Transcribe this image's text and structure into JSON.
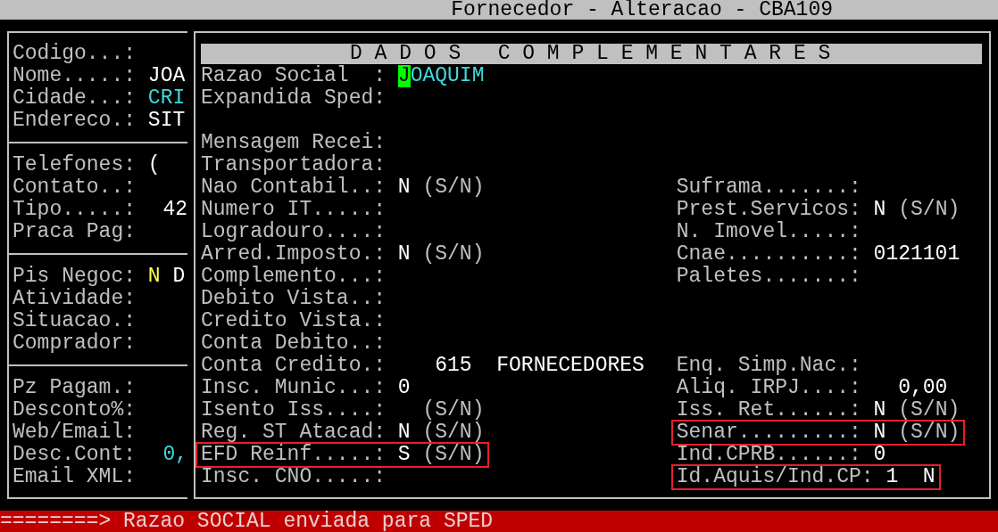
{
  "window": {
    "title": "Fornecedor - Alteracao - CBA109"
  },
  "summary_panel": {
    "sections": [
      {
        "rows": [
          {
            "label": "Codigo...:"
          },
          {
            "label": "Nome.....:",
            "values": [
              {
                "text": "JOA",
                "color": "#ffffff",
                "kind": "text"
              }
            ]
          },
          {
            "label": "Cidade...:",
            "values": [
              {
                "text": "CRI",
                "color": "#40d8d8",
                "kind": "text"
              }
            ]
          },
          {
            "label": "Endereco.:",
            "values": [
              {
                "text": "SIT",
                "color": "#ffffff",
                "kind": "text"
              }
            ]
          }
        ]
      },
      {
        "rows": [
          {
            "label": "Telefones:",
            "values": [
              {
                "text": "(",
                "color": "#ffffff",
                "kind": "text"
              }
            ]
          },
          {
            "label": "Contato..:"
          },
          {
            "label": "Tipo.....:",
            "values": [
              {
                "text": "42",
                "color": "#ffffff",
                "kind": "number"
              }
            ]
          },
          {
            "label": "Praca Pag:"
          }
        ]
      },
      {
        "rows": [
          {
            "label": "Pis Negoc:",
            "values": [
              {
                "text": "N",
                "color": "#ffff55",
                "kind": "text"
              },
              {
                "text": "D",
                "color": "#ffffff",
                "kind": "text"
              }
            ]
          },
          {
            "label": "Atividade:"
          },
          {
            "label": "Situacao.:"
          },
          {
            "label": "Comprador:"
          }
        ]
      },
      {
        "rows": [
          {
            "label": "Pz Pagam.:"
          },
          {
            "label": "Desconto%:"
          },
          {
            "label": "Web/Email:"
          },
          {
            "label": "Desc.Cont:",
            "values": [
              {
                "text": "0,",
                "color": "#40d8d8",
                "kind": "number"
              }
            ]
          },
          {
            "label": "Email XML:"
          }
        ]
      }
    ]
  },
  "details_panel": {
    "heading": "D A D O S   C O M P L E M E N T A R E S",
    "rows": [
      {
        "kind": "fields",
        "left": {
          "label": "Razao Social  :",
          "value": {
            "text": "JOAQUIM",
            "color": "#40d8d8",
            "kind": "text",
            "cursor": true
          },
          "highlighted": false
        }
      },
      {
        "kind": "fields",
        "left": {
          "label": "Expandida Sped:",
          "highlighted": false
        }
      },
      {
        "kind": "blank"
      },
      {
        "kind": "fields",
        "left": {
          "label": "Mensagem Recei:",
          "highlighted": false
        }
      },
      {
        "kind": "fields",
        "left": {
          "label": "Transportadora:",
          "highlighted": false
        }
      },
      {
        "kind": "fields",
        "left": {
          "label": "Nao Contabil..:",
          "value": {
            "text": "N",
            "color": "#ffffff",
            "kind": "text"
          },
          "hint": "(S/N)",
          "highlighted": false
        },
        "right": {
          "label": "Suframa.......:",
          "highlighted": false
        }
      },
      {
        "kind": "fields",
        "left": {
          "label": "Numero IT.....:",
          "highlighted": false
        },
        "right": {
          "label": "Prest.Servicos:",
          "value": {
            "text": "N",
            "color": "#ffffff",
            "kind": "text"
          },
          "hint": "(S/N)",
          "highlighted": false
        }
      },
      {
        "kind": "fields",
        "left": {
          "label": "Logradouro....:",
          "highlighted": false
        },
        "right": {
          "label": "N. Imovel.....:",
          "highlighted": false
        }
      },
      {
        "kind": "fields",
        "left": {
          "label": "Arred.Imposto.:",
          "value": {
            "text": "N",
            "color": "#ffffff",
            "kind": "text"
          },
          "hint": "(S/N)",
          "highlighted": false
        },
        "right": {
          "label": "Cnae..........:",
          "value": {
            "text": "0121101",
            "color": "#ffffff",
            "kind": "text"
          },
          "highlighted": false
        }
      },
      {
        "kind": "fields",
        "left": {
          "label": "Complemento...:",
          "highlighted": false
        },
        "right": {
          "label": "Paletes.......:",
          "highlighted": false
        }
      },
      {
        "kind": "fields",
        "left": {
          "label": "Debito Vista..:",
          "highlighted": false
        }
      },
      {
        "kind": "fields",
        "left": {
          "label": "Credito Vista.:",
          "highlighted": false
        }
      },
      {
        "kind": "fields",
        "left": {
          "label": "Conta Debito..:",
          "highlighted": false
        }
      },
      {
        "kind": "fields",
        "left": {
          "label": "Conta Credito.:",
          "value": {
            "text": "615",
            "color": "#ffffff",
            "kind": "number"
          },
          "note": "FORNECEDORES",
          "highlighted": false
        },
        "right": {
          "label": "Enq. Simp.Nac.:",
          "highlighted": false
        }
      },
      {
        "kind": "fields",
        "left": {
          "label": "Insc. Munic...:",
          "value": {
            "text": "0",
            "color": "#ffffff",
            "kind": "text"
          },
          "highlighted": false
        },
        "right": {
          "label": "Aliq. IRPJ....:",
          "value": {
            "text": "0,00",
            "color": "#ffffff",
            "kind": "number"
          },
          "highlighted": false
        }
      },
      {
        "kind": "fields",
        "left": {
          "label": "Isento Iss....:",
          "hint": "(S/N)",
          "highlighted": false
        },
        "right": {
          "label": "Iss. Ret......:",
          "value": {
            "text": "N",
            "color": "#ffffff",
            "kind": "text"
          },
          "hint": "(S/N)",
          "highlighted": false
        }
      },
      {
        "kind": "fields",
        "left": {
          "label": "Reg. ST Atacad:",
          "value": {
            "text": "N",
            "color": "#ffffff",
            "kind": "text"
          },
          "hint": "(S/N)",
          "highlighted": false
        },
        "right": {
          "label": "Senar.........:",
          "value": {
            "text": "N",
            "color": "#ffffff",
            "kind": "text"
          },
          "hint": "(S/N)",
          "highlighted": true
        }
      },
      {
        "kind": "fields",
        "left": {
          "label": "EFD Reinf.....:",
          "value": {
            "text": "S",
            "color": "#ffffff",
            "kind": "text"
          },
          "hint": "(S/N)",
          "highlighted": true
        },
        "right": {
          "label": "Ind.CPRB......:",
          "value": {
            "text": "0",
            "color": "#ffffff",
            "kind": "text"
          },
          "highlighted": false
        }
      },
      {
        "kind": "fields",
        "left": {
          "label": "Insc. CNO.....:",
          "highlighted": false
        },
        "right": {
          "label": "Id.Aquis/Ind.CP:",
          "value": {
            "text": "1  N",
            "color": "#ffffff",
            "kind": "text"
          },
          "highlighted": true
        }
      }
    ]
  },
  "status_bar": {
    "message": "========> Razao SOCIAL enviada para SPED"
  }
}
